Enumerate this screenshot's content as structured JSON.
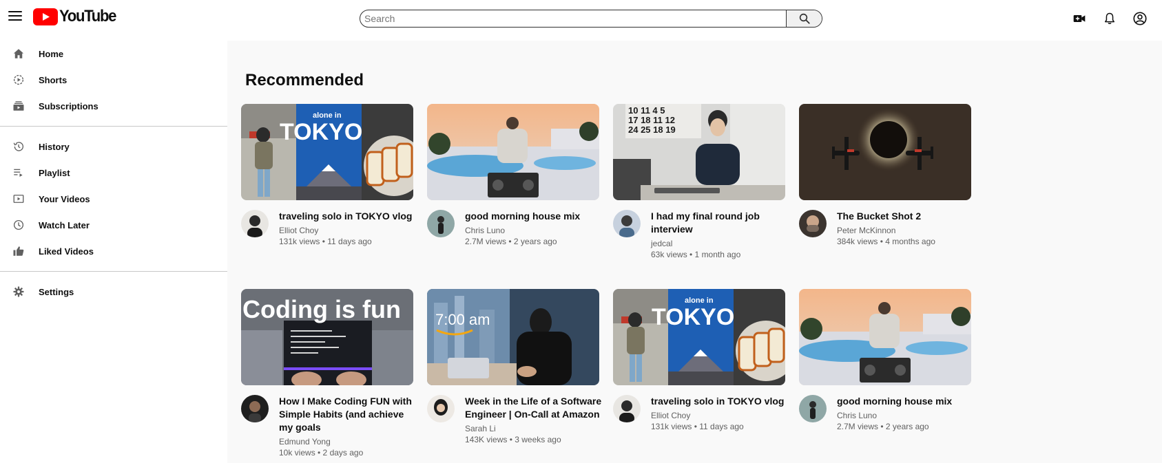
{
  "header": {
    "logo_text": "YouTube",
    "search_placeholder": "Search"
  },
  "colors": {
    "brand_red": "#ff0000",
    "main_background": "#f9f9f9",
    "text_primary": "#0f0f0f",
    "text_secondary": "#606060"
  },
  "sidebar": {
    "items": [
      {
        "label": "Home",
        "icon": "home-icon"
      },
      {
        "label": "Shorts",
        "icon": "shorts-icon"
      },
      {
        "label": "Subscriptions",
        "icon": "subscriptions-icon"
      },
      {
        "label": "History",
        "icon": "history-icon"
      },
      {
        "label": "Playlist",
        "icon": "playlist-icon"
      },
      {
        "label": "Your Videos",
        "icon": "your-videos-icon"
      },
      {
        "label": "Watch Later",
        "icon": "watch-later-icon"
      },
      {
        "label": "Liked Videos",
        "icon": "like-icon"
      },
      {
        "label": "Settings",
        "icon": "gear-icon"
      }
    ]
  },
  "main": {
    "section_title": "Recommended",
    "videos": [
      {
        "title": "traveling solo in TOKYO vlog",
        "channel": "Elliot Choy",
        "stats": "131k views • 11 days ago",
        "thumb_text": "alone in TOKYO"
      },
      {
        "title": "good morning house mix",
        "channel": "Chris Luno",
        "stats": "2.7M views • 2 years ago"
      },
      {
        "title": "I had my final round job interview",
        "channel": "jedcal",
        "stats": "63k views • 1 month ago"
      },
      {
        "title": "The Bucket Shot 2",
        "channel": "Peter McKinnon",
        "stats": "384k views • 4 months ago"
      },
      {
        "title": "How I Make Coding FUN with Simple Habits (and achieve my goals",
        "channel": "Edmund Yong",
        "stats": "10k views • 2 days ago",
        "thumb_text": "Coding is fun"
      },
      {
        "title": "Week in the Life of a Software Engineer | On-Call at Amazon",
        "channel": "Sarah Li",
        "stats": "143K views • 3 weeks ago",
        "thumb_text": "7:00 am"
      },
      {
        "title": "traveling solo in TOKYO vlog",
        "channel": "Elliot Choy",
        "stats": "131k views • 11 days ago",
        "thumb_text": "alone in TOKYO"
      },
      {
        "title": "good morning house mix",
        "channel": "Chris Luno",
        "stats": "2.7M views • 2 years ago"
      }
    ]
  }
}
